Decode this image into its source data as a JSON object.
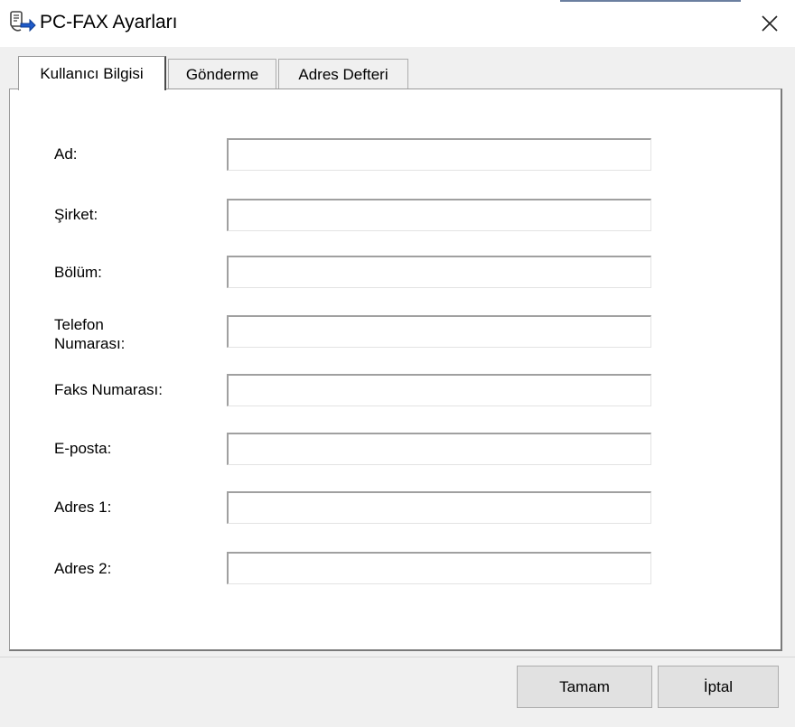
{
  "window": {
    "title": "PC-FAX Ayarları",
    "title_icon": "fax-settings-icon",
    "close_glyph": "✕"
  },
  "tabs": [
    {
      "label": "Kullanıcı Bilgisi",
      "active": true
    },
    {
      "label": "Gönderme",
      "active": false
    },
    {
      "label": "Adres Defteri",
      "active": false
    }
  ],
  "form": {
    "fields": [
      {
        "label": "Ad:",
        "value": ""
      },
      {
        "label": "Şirket:",
        "value": ""
      },
      {
        "label": "Bölüm:",
        "value": ""
      },
      {
        "label": "Telefon\nNumarası:",
        "value": ""
      },
      {
        "label": "Faks Numarası:",
        "value": ""
      },
      {
        "label": "E-posta:",
        "value": ""
      },
      {
        "label": "Adres 1:",
        "value": ""
      },
      {
        "label": "Adres 2:",
        "value": ""
      }
    ]
  },
  "buttons": {
    "ok_label": "Tamam",
    "cancel_label": "İptal"
  }
}
